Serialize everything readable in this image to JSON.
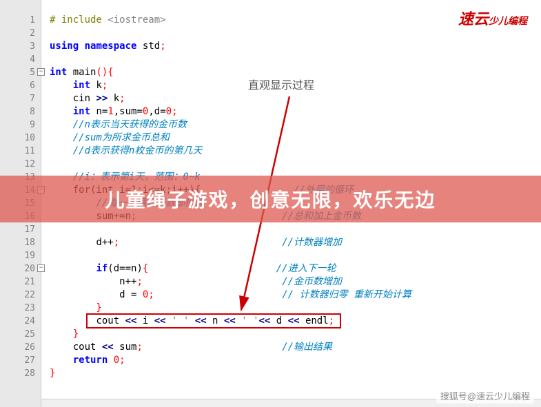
{
  "logo": {
    "main": "速云",
    "sub": "少儿编程"
  },
  "annotation": "直观显示过程",
  "overlay_banner": "儿童绳子游戏，创意无限，欢乐无边",
  "watermark": "搜狐号@速云少儿编程",
  "line_numbers": [
    "1",
    "2",
    "3",
    "4",
    "5",
    "6",
    "7",
    "8",
    "9",
    "10",
    "11",
    "12",
    "13",
    "14",
    "15",
    "16",
    "17",
    "18",
    "19",
    "20",
    "21",
    "22",
    "23",
    "24",
    "25",
    "26",
    "27",
    "28"
  ],
  "code": {
    "l1_pp": "# include ",
    "l1_inc": "<iostream>",
    "l3_kw1": "using",
    "l3_kw2": "namespace",
    "l3_id": "std",
    "l3_p": ";",
    "l5_kw": "int",
    "l5_fn": "main",
    "l5_p": "(){",
    "l6_kw": "int",
    "l6_id": "k",
    "l6_p": ";",
    "l7_a": "cin ",
    "l7_op": ">>",
    "l7_b": " k",
    "l7_p": ";",
    "l8_kw": "int",
    "l8_a": " n=",
    "l8_n1": "1",
    "l8_b": ",sum=",
    "l8_n2": "0",
    "l8_c": ",d=",
    "l8_n3": "0",
    "l8_p": ";",
    "l9": "//n表示当天获得的金币数",
    "l10": "//sum为所求金币总和",
    "l11": "//d表示获得n枚金币的第几天",
    "l13": "//i：表示第i天，范围：0~k",
    "l14_a": "for(int i=1;i<=k;i++){",
    "l14_c": "//外层的循环",
    "l15_a": "//每一个循环天数都操作",
    "l16_a": "sum+=n",
    "l16_p": ";",
    "l16_c": "//总和加上金币数",
    "l18_a": "d++",
    "l18_p": ";",
    "l18_c": "//计数器增加",
    "l20_kw": "if",
    "l20_a": "(d==n)",
    "l20_p": "{",
    "l20_c": "//进入下一轮",
    "l21_a": "n++",
    "l21_p": ";",
    "l21_c": "//金币数增加",
    "l22_a": "d = ",
    "l22_n": "0",
    "l22_p": ";",
    "l22_c": "// 计数器归零 重新开始计算",
    "l23_p": "}",
    "l24_a": "cout ",
    "l24_op1": "<<",
    "l24_b": " i ",
    "l24_op2": "<<",
    "l24_s1": " ' ' ",
    "l24_op3": "<<",
    "l24_c": " n ",
    "l24_op4": "<<",
    "l24_s2": " ' '",
    "l24_op5": "<<",
    "l24_d": " d ",
    "l24_op6": "<<",
    "l24_e": " endl",
    "l24_p": ";",
    "l25_p": "}",
    "l26_a": "cout ",
    "l26_op": "<<",
    "l26_b": " sum",
    "l26_p": ";",
    "l26_c": "//输出结果",
    "l27_kw": "return",
    "l27_n": " 0",
    "l27_p": ";",
    "l28_p": "}"
  }
}
